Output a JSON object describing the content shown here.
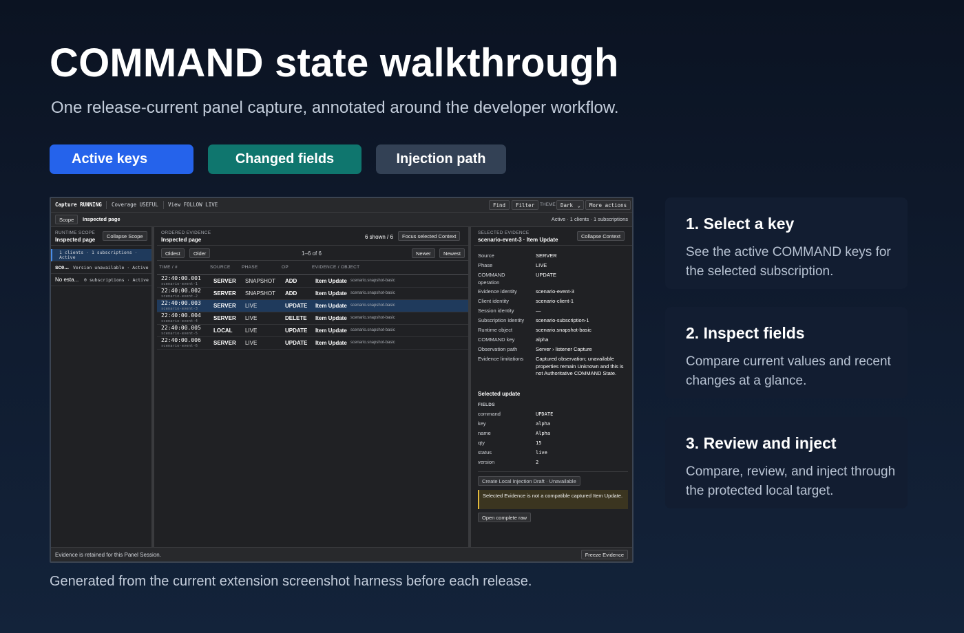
{
  "title": "COMMAND state walkthrough",
  "subtitle": "One release-current panel capture, annotated around the developer workflow.",
  "pills": [
    "Active keys",
    "Changed fields",
    "Injection path"
  ],
  "caption": "Generated from the current extension screenshot harness before each release.",
  "colors": {
    "accent_blue": "#2563eb",
    "accent_teal": "#0f766e",
    "neutral": "#334155",
    "warning": "#e2b93b"
  },
  "cards": [
    {
      "title": "1. Select a key",
      "body": "See the active COMMAND keys for the selected subscription."
    },
    {
      "title": "2. Inspect fields",
      "body": "Compare current values and recent changes at a glance."
    },
    {
      "title": "3. Review and inject",
      "body": "Compare, review, and inject through the protected local target."
    }
  ],
  "shot": {
    "toolbar": {
      "capture_label": "Capture",
      "capture_value": "RUNNING",
      "coverage_label": "Coverage",
      "coverage_value": "USEFUL",
      "view_label": "View",
      "view_value": "FOLLOW LIVE",
      "find": "Find",
      "filter": "Filter",
      "theme_label": "THEME",
      "theme_value": "Dark",
      "more": "More actions"
    },
    "scope_bar": {
      "scope_button": "Scope",
      "scope_value": "Inspected page",
      "status": "Active · 1 clients · 1 subscriptions"
    },
    "left": {
      "caption": "RUNTIME SCOPE",
      "title": "Inspected page",
      "collapse": "Collapse Scope",
      "selected_summary": "1 clients · 1 subscriptions · Active",
      "items": [
        {
          "name": "sce...",
          "detail": "Version unavailable · Active"
        },
        {
          "name": "No esta...",
          "detail": "0 subscriptions · Active"
        }
      ]
    },
    "mid": {
      "caption": "ORDERED EVIDENCE",
      "title": "Inspected page",
      "count": "6 shown / 6",
      "focus": "Focus selected Context",
      "oldest": "Oldest",
      "older": "Older",
      "range": "1–6 of 6",
      "newer": "Newer",
      "newest": "Newest",
      "columns": [
        "TIME / #",
        "SOURCE",
        "PHASE",
        "OP",
        "EVIDENCE / OBJECT"
      ],
      "rows": [
        {
          "time": "22:40:00.001",
          "id": "scenario-event-1",
          "source": "SERVER",
          "phase": "SNAPSHOT",
          "op": "ADD",
          "evidence": "Item Update",
          "object": "scenario.snapshot-basic"
        },
        {
          "time": "22:40:00.002",
          "id": "scenario-event-2",
          "source": "SERVER",
          "phase": "SNAPSHOT",
          "op": "ADD",
          "evidence": "Item Update",
          "object": "scenario.snapshot-basic"
        },
        {
          "time": "22:40:00.003",
          "id": "scenario-event-3",
          "source": "SERVER",
          "phase": "LIVE",
          "op": "UPDATE",
          "evidence": "Item Update",
          "object": "scenario.snapshot-basic"
        },
        {
          "time": "22:40:00.004",
          "id": "scenario-event-4",
          "source": "SERVER",
          "phase": "LIVE",
          "op": "DELETE",
          "evidence": "Item Update",
          "object": "scenario.snapshot-basic"
        },
        {
          "time": "22:40:00.005",
          "id": "scenario-event-5",
          "source": "LOCAL",
          "phase": "LIVE",
          "op": "UPDATE",
          "evidence": "Item Update",
          "object": "scenario.snapshot-basic"
        },
        {
          "time": "22:40:00.006",
          "id": "scenario-event-6",
          "source": "SERVER",
          "phase": "LIVE",
          "op": "UPDATE",
          "evidence": "Item Update",
          "object": "scenario.snapshot-basic"
        }
      ]
    },
    "right": {
      "caption": "SELECTED EVIDENCE",
      "title": "scenario-event-3 · Item Update",
      "collapse": "Collapse Context",
      "details": [
        {
          "k": "Source",
          "v": "SERVER"
        },
        {
          "k": "Phase",
          "v": "LIVE"
        },
        {
          "k": "COMMAND operation",
          "v": "UPDATE"
        },
        {
          "k": "Evidence identity",
          "v": "scenario-event-3"
        },
        {
          "k": "Client identity",
          "v": "scenario-client-1"
        },
        {
          "k": "Session identity",
          "v": "—"
        },
        {
          "k": "Subscription identity",
          "v": "scenario-subscription-1"
        },
        {
          "k": "Runtime object",
          "v": "scenario.snapshot-basic"
        },
        {
          "k": "COMMAND key",
          "v": "alpha"
        },
        {
          "k": "Observation path",
          "v": "Server › listener Capture"
        },
        {
          "k": "Evidence limitations",
          "v": "Captured observation; unavailable properties remain Unknown and this is not Authoritative COMMAND State."
        }
      ],
      "selected_update": "Selected update",
      "fields_label": "FIELDS",
      "fields": [
        {
          "k": "command",
          "v": "UPDATE"
        },
        {
          "k": "key",
          "v": "alpha"
        },
        {
          "k": "name",
          "v": "Alpha"
        },
        {
          "k": "qty",
          "v": "15"
        },
        {
          "k": "status",
          "v": "live"
        },
        {
          "k": "version",
          "v": "2"
        }
      ],
      "inject_draft": "Create Local Injection Draft · Unavailable",
      "warning": "Selected Evidence is not a compatible captured Item Update.",
      "open_raw": "Open complete raw"
    },
    "footer": {
      "note": "Evidence is retained for this Panel Session.",
      "freeze": "Freeze Evidence"
    }
  }
}
